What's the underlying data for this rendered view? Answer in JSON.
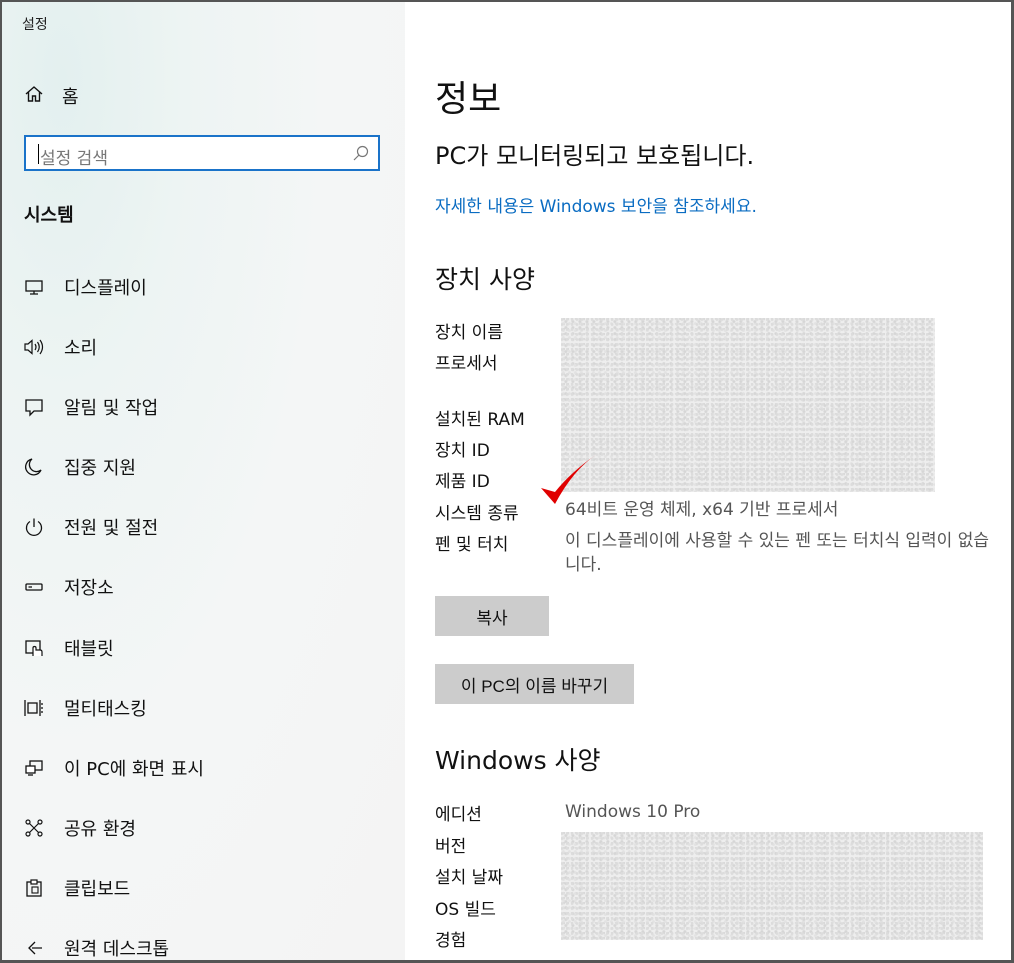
{
  "window": {
    "title": "설정"
  },
  "sidebar": {
    "home_label": "홈",
    "search_placeholder": "설정 검색",
    "section_label": "시스템",
    "items": [
      {
        "label": "디스플레이",
        "icon": "monitor-icon"
      },
      {
        "label": "소리",
        "icon": "speaker-icon"
      },
      {
        "label": "알림 및 작업",
        "icon": "notification-icon"
      },
      {
        "label": "집중 지원",
        "icon": "moon-icon"
      },
      {
        "label": "전원 및 절전",
        "icon": "power-icon"
      },
      {
        "label": "저장소",
        "icon": "storage-icon"
      },
      {
        "label": "태블릿",
        "icon": "tablet-icon"
      },
      {
        "label": "멀티태스킹",
        "icon": "multitasking-icon"
      },
      {
        "label": "이 PC에 화면 표시",
        "icon": "project-icon"
      },
      {
        "label": "공유 환경",
        "icon": "share-icon"
      },
      {
        "label": "클립보드",
        "icon": "clipboard-icon"
      },
      {
        "label": "원격 데스크톱",
        "icon": "remote-desktop-icon"
      }
    ]
  },
  "main": {
    "title": "정보",
    "protection_status": "PC가 모니터링되고 보호됩니다.",
    "security_link": "자세한 내용은 Windows 보안을 참조하세요.",
    "device_specs": {
      "heading": "장치 사양",
      "labels": {
        "device_name": "장치 이름",
        "processor": "프로세서",
        "ram": "설치된 RAM",
        "device_id": "장치 ID",
        "product_id": "제품 ID",
        "system_type": "시스템 종류",
        "pen_touch": "펜 및 터치"
      },
      "values": {
        "system_type": "64비트 운영 체제, x64 기반 프로세서",
        "pen_touch": "이 디스플레이에 사용할 수 있는 펜 또는 터치식 입력이 없습니다."
      },
      "copy_button": "복사",
      "rename_button": "이 PC의 이름 바꾸기"
    },
    "windows_specs": {
      "heading": "Windows 사양",
      "labels": {
        "edition": "에디션",
        "version": "버전",
        "installed_on": "설치 날짜",
        "os_build": "OS 빌드",
        "experience": "경험"
      },
      "values": {
        "edition": "Windows 10 Pro"
      }
    }
  },
  "colors": {
    "accent": "#0a6cc2",
    "search_border": "#1a73c9",
    "button_bg": "#cccccc",
    "checkmark": "#e00000"
  }
}
